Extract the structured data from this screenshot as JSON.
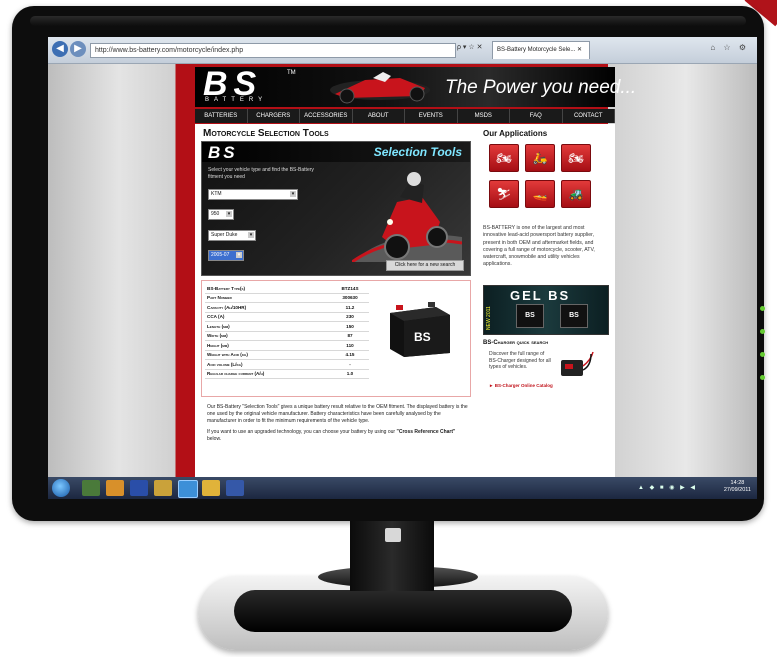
{
  "browser": {
    "url": "http://www.bs-battery.com/motorcycle/index.php",
    "addr_tools": "ρ ▾ ☆ ✕",
    "tab_title": "BS-Battery Motorcycle Sele...",
    "tab_close": "✕",
    "back": "◀",
    "forward": "▶",
    "toolbar_icons": "⌂ ☆ ⚙"
  },
  "header": {
    "logo": "BS",
    "logo_sub": "BATTERY",
    "tm": "TM",
    "tagline": "The Power you need..."
  },
  "nav": {
    "items": [
      "Batteries",
      "Chargers",
      "Accessories",
      "About",
      "Events",
      "MSDS",
      "FAQ",
      "Contact"
    ]
  },
  "tools": {
    "section_title": "Motorcycle Selection Tools",
    "panel_logo": "BS",
    "panel_title": "Selection Tools",
    "instructions": "Select your vehicle type and find the BS-Battery fitment you need",
    "make": "KTM",
    "cc": "950",
    "model": "Super Duke",
    "year": "2005-07",
    "new_search": "Click here for a new search"
  },
  "specs": {
    "rows": [
      {
        "label": "BS-Battery Type(s)",
        "value": "BTZ14S"
      },
      {
        "label": "Part Number",
        "value": "300630"
      },
      {
        "label": "Capacity (Ah/10HR)",
        "value": "11.2"
      },
      {
        "label": "CCA (A)",
        "value": "230"
      },
      {
        "label": "Length (mm)",
        "value": "150"
      },
      {
        "label": "Width (mm)",
        "value": "87"
      },
      {
        "label": "Height (mm)",
        "value": "110"
      },
      {
        "label": "Weight with Acid (kg)",
        "value": "4.15"
      },
      {
        "label": "Acid volume (L/kg)",
        "value": "-"
      },
      {
        "label": "Regular charge current (A/h)",
        "value": "1.0"
      }
    ],
    "battery_brand": "BS"
  },
  "description": {
    "p1": "Our BS-Battery \"Selection Tools\" gives a unique battery result relative to the OEM fitment. The displayed battery is the one used by the original vehicle manufacturer. Battery characteristics have been carefully analysed by the manufacturer in order to fit the minimum requirements of the vehicle type.",
    "p2": "If you want to use an upgraded technology, you can choose your battery by using our",
    "p2_link": "\"Cross Reference Chart\"",
    "p2_end": "below."
  },
  "applications": {
    "title": "Our Applications",
    "icons": [
      "motorcycle-icon",
      "scooter-icon",
      "atv-icon",
      "snowmobile-icon",
      "watercraft-icon",
      "utility-vehicle-icon"
    ],
    "about": "BS-BATTERY is one of the largest and most innovative lead-acid powersport battery supplier, present in both OEM and aftermarket fields, and covering a full range of motorcycle, scooter, ATV, watercraft, snowmobile and utility vehicles applications."
  },
  "gel": {
    "title": "GEL BS",
    "side": "NEW 2011",
    "bat1": "BS",
    "bat2": "BS"
  },
  "charger": {
    "title": "BS-Charger quick search",
    "text": "Discover the full range of BS-Charger designed for all types of vehicles.",
    "link": "► BS-Charger Online Catalog"
  },
  "taskbar": {
    "tray": "▲ ◆ ■ ◉ ▶ ◀",
    "time": "14:28",
    "date": "27/09/2011"
  },
  "colors": {
    "brand_red": "#b30f16",
    "header_black": "#000000",
    "accent_cyan": "#7fe6ff"
  }
}
